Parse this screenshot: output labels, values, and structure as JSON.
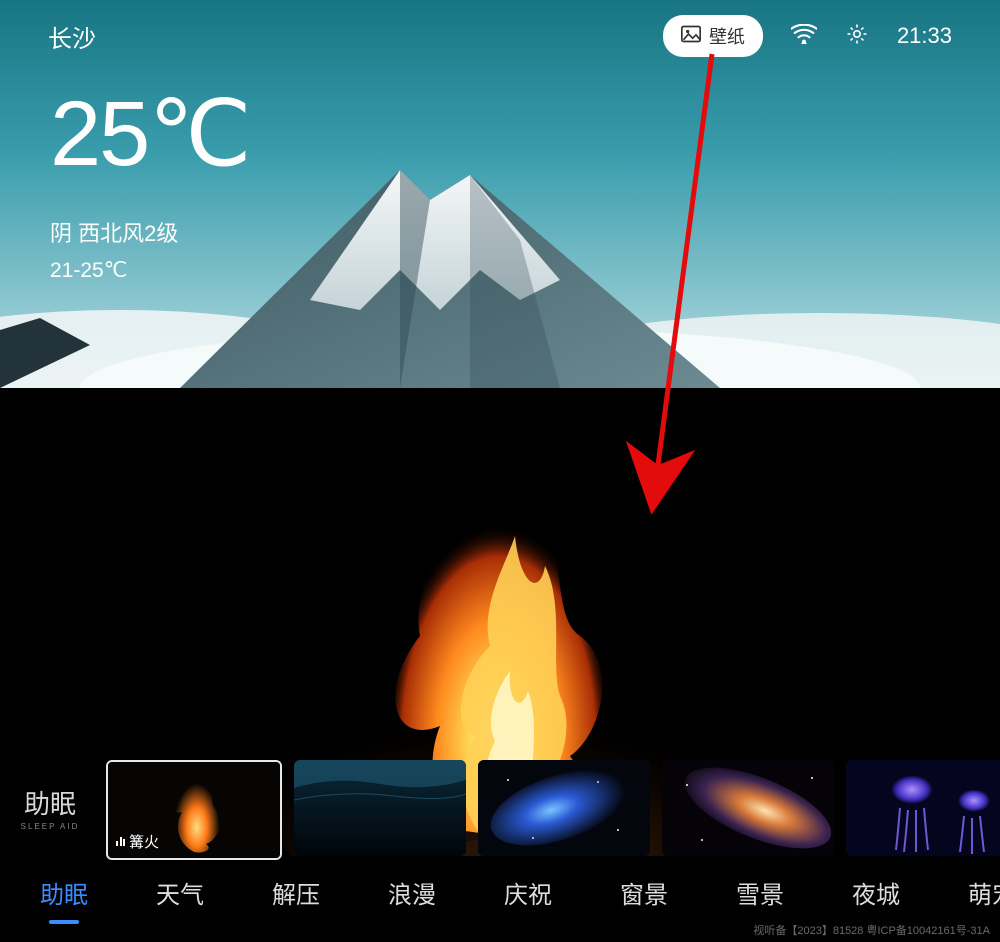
{
  "header": {
    "location": "长沙",
    "wallpaper_label": "壁纸",
    "clock": "21:33"
  },
  "weather": {
    "temperature": "25℃",
    "conditions": "阴 西北风2级",
    "temp_range": "21-25℃"
  },
  "side_label": {
    "main": "助眠",
    "sub": "SLEEP AID"
  },
  "thumbs": [
    {
      "label": "篝火",
      "selected": true
    },
    {
      "label": "",
      "selected": false
    },
    {
      "label": "",
      "selected": false
    },
    {
      "label": "",
      "selected": false
    },
    {
      "label": "",
      "selected": false
    }
  ],
  "tabs": [
    {
      "label": "助眠",
      "active": true
    },
    {
      "label": "天气",
      "active": false
    },
    {
      "label": "解压",
      "active": false
    },
    {
      "label": "浪漫",
      "active": false
    },
    {
      "label": "庆祝",
      "active": false
    },
    {
      "label": "窗景",
      "active": false
    },
    {
      "label": "雪景",
      "active": false
    },
    {
      "label": "夜城",
      "active": false
    },
    {
      "label": "萌宠",
      "active": false
    }
  ],
  "footer": "视听备【2023】81528 粤ICP备10042161号-31A"
}
